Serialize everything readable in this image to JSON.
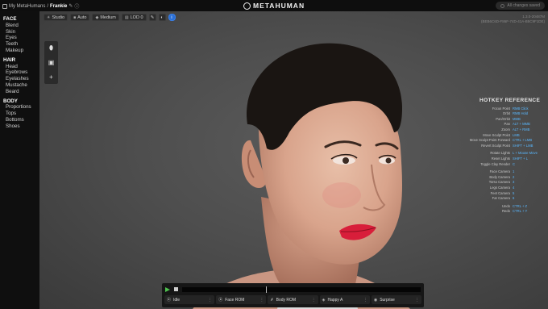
{
  "header": {
    "breadcrumb_root": "My MetaHumans",
    "breadcrumb_sep": "/",
    "breadcrumb_current": "Frankie",
    "edit_icon": "pencil-icon",
    "help_icon": "help-icon",
    "logo_text": "METAHUMAN",
    "saved_status": "All changes saved"
  },
  "sidebar": {
    "sections": [
      {
        "title": "FACE",
        "items": [
          "Blend",
          "Skin",
          "Eyes",
          "Teeth",
          "Makeup"
        ]
      },
      {
        "title": "HAIR",
        "items": [
          "Head",
          "Eyebrows",
          "Eyelashes",
          "Mustache",
          "Beard"
        ]
      },
      {
        "title": "BODY",
        "items": [
          "Proportions",
          "Tops",
          "Bottoms",
          "Shoes"
        ]
      }
    ]
  },
  "viewport_toolbar": {
    "studio": "Studio",
    "auto": "Auto",
    "medium": "Medium",
    "lod": "LOD 0",
    "active_badge": "i"
  },
  "version": {
    "line1": "1.3.0-20487M",
    "line2": "(BEB6C6D-F86F-74D-41A-B5C9F1DE)"
  },
  "hotkeys": {
    "title": "HOTKEY REFERENCE",
    "rows": [
      [
        "Focus Point",
        "RMB Click"
      ],
      [
        "Orbit",
        "RMB Hold"
      ],
      [
        "Pan/Orbit",
        "MMB"
      ],
      [
        "Pan",
        "ALT + MMB"
      ],
      [
        "Zoom",
        "ALT + RMB"
      ],
      [
        "Move Sculpt Point",
        "LMB"
      ],
      [
        "Move Sculpt Point Forward",
        "CTRL + LMB"
      ],
      [
        "Revert Sculpt Point",
        "SHIFT + LMB"
      ],
      null,
      [
        "Rotate Lights",
        "L + Mouse Move"
      ],
      [
        "Reset Lights",
        "SHIFT + L"
      ],
      [
        "Toggle Clay Render",
        "C"
      ],
      null,
      [
        "Face Camera",
        "1"
      ],
      [
        "Body Camera",
        "2"
      ],
      [
        "Torso Camera",
        "3"
      ],
      [
        "Legs Camera",
        "4"
      ],
      [
        "Feet Camera",
        "5"
      ],
      [
        "Far Camera",
        "6"
      ],
      null,
      [
        "Undo",
        "CTRL + Z"
      ],
      [
        "Redo",
        "CTRL + Y"
      ]
    ]
  },
  "timeline": {
    "playhead_fraction": 0.35,
    "animations": [
      "Idle",
      "Face ROM",
      "Body ROM",
      "Happy A",
      "Surprise"
    ]
  },
  "colors": {
    "accent": "#2a6fd6",
    "hotkey_value": "#59b8ff",
    "play": "#4fc34f",
    "lips": "#d81e3a"
  }
}
